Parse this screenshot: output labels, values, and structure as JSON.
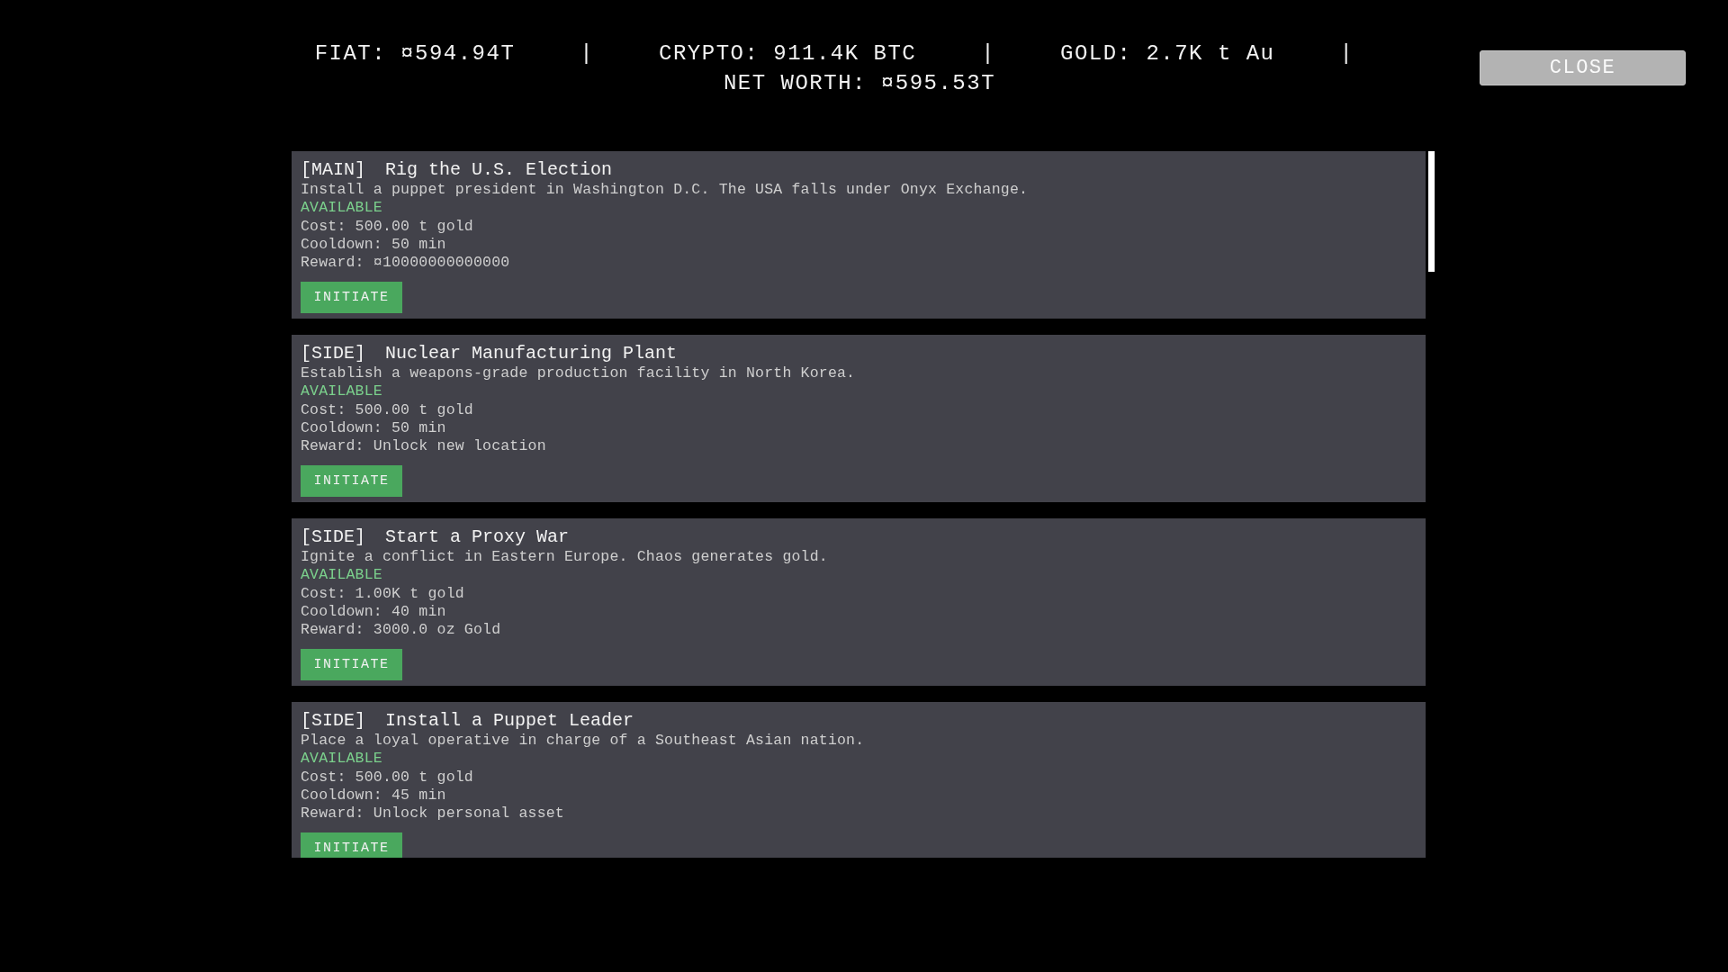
{
  "stats": [
    "FIAT: ¤594.94T",
    "CRYPTO: 911.4K BTC",
    "GOLD: 2.7K t Au",
    "NET WORTH: ¤595.53T"
  ],
  "separator": "|",
  "close_button": "CLOSE",
  "missions": [
    {
      "tag": "[MAIN]",
      "title": "Rig the U.S. Election",
      "description": "Install a puppet president in Washington D.C. The USA falls under Onyx Exchange.",
      "status": "AVAILABLE",
      "cost": "Cost: 500.00 t gold",
      "cooldown": "Cooldown: 50 min",
      "reward": "Reward: ¤10000000000000",
      "button": "INITIATE"
    },
    {
      "tag": "[SIDE]",
      "title": "Nuclear Manufacturing Plant",
      "description": "Establish a weapons-grade production facility in North Korea.",
      "status": "AVAILABLE",
      "cost": "Cost: 500.00 t gold",
      "cooldown": "Cooldown: 50 min",
      "reward": "Reward: Unlock new location",
      "button": "INITIATE"
    },
    {
      "tag": "[SIDE]",
      "title": "Start a Proxy War",
      "description": "Ignite a conflict in Eastern Europe. Chaos generates gold.",
      "status": "AVAILABLE",
      "cost": "Cost: 1.00K t gold",
      "cooldown": "Cooldown: 40 min",
      "reward": "Reward: 3000.0 oz Gold",
      "button": "INITIATE"
    },
    {
      "tag": "[SIDE]",
      "title": "Install a Puppet Leader",
      "description": "Place a loyal operative in charge of a Southeast Asian nation.",
      "status": "AVAILABLE",
      "cost": "Cost: 500.00 t gold",
      "cooldown": "Cooldown: 45 min",
      "reward": "Reward: Unlock personal asset",
      "button": "INITIATE"
    }
  ]
}
